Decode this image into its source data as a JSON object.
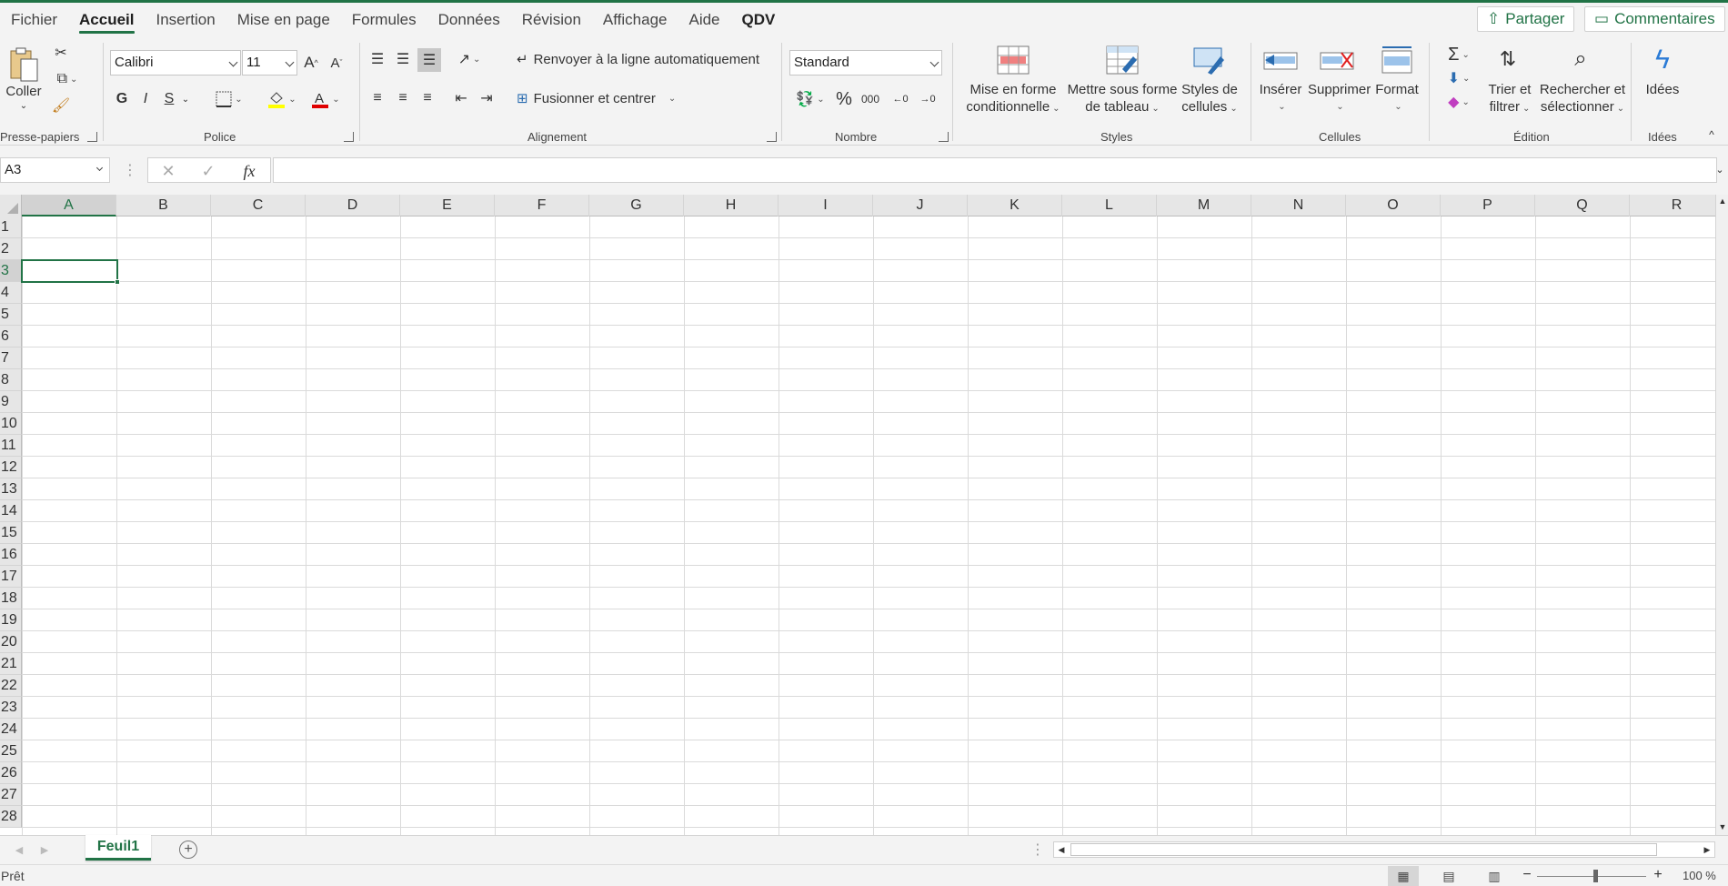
{
  "tabs": [
    "Fichier",
    "Accueil",
    "Insertion",
    "Mise en page",
    "Formules",
    "Données",
    "Révision",
    "Affichage",
    "Aide",
    "QDV"
  ],
  "share_label": "Partager",
  "comments_label": "Commentaires",
  "clipboard": {
    "paste_label": "Coller",
    "group_label": "Presse-papiers"
  },
  "font": {
    "name": "Calibri",
    "size": "11",
    "bold": "G",
    "italic": "I",
    "underline": "S",
    "group_label": "Police"
  },
  "alignment": {
    "wrap_label": "Renvoyer à la ligne automatiquement",
    "merge_label": "Fusionner et centrer",
    "group_label": "Alignement"
  },
  "number": {
    "format": "Standard",
    "percent": "%",
    "thousands": "000",
    "group_label": "Nombre"
  },
  "styles": {
    "conditional_line1": "Mise en forme",
    "conditional_line2": "conditionnelle",
    "table_line1": "Mettre sous forme",
    "table_line2": "de tableau",
    "cell_styles_line1": "Styles de",
    "cell_styles_line2": "cellules",
    "group_label": "Styles"
  },
  "cells": {
    "insert": "Insérer",
    "delete": "Supprimer",
    "format": "Format",
    "group_label": "Cellules"
  },
  "editing": {
    "sort_line1": "Trier et",
    "sort_line2": "filtrer",
    "find_line1": "Rechercher et",
    "find_line2": "sélectionner",
    "group_label": "Édition"
  },
  "ideas": {
    "label": "Idées",
    "group_label": "Idées"
  },
  "formula_bar": {
    "name_box": "A3",
    "fx": "fx",
    "formula": ""
  },
  "columns": [
    "A",
    "B",
    "C",
    "D",
    "E",
    "F",
    "G",
    "H",
    "I",
    "J",
    "K",
    "L",
    "M",
    "N",
    "O",
    "P",
    "Q",
    "R"
  ],
  "rows": [
    "1",
    "2",
    "3",
    "4",
    "5",
    "6",
    "7",
    "8",
    "9",
    "10",
    "11",
    "12",
    "13",
    "14",
    "15",
    "16",
    "17",
    "18",
    "19",
    "20",
    "21",
    "22",
    "23",
    "24",
    "25",
    "26",
    "27",
    "28"
  ],
  "selected_cell": "A3",
  "sheets": [
    "Feuil1"
  ],
  "status": {
    "text": "Prêt",
    "zoom": "100 %"
  },
  "accent_color": "#217346"
}
